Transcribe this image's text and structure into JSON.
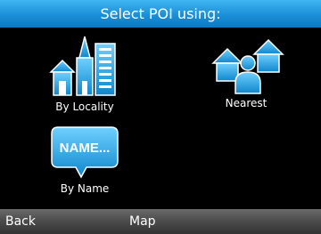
{
  "header": {
    "title": "Select POI using:"
  },
  "options": [
    {
      "label": "By Locality",
      "icon": "city-buildings-icon"
    },
    {
      "label": "Nearest",
      "icon": "nearby-person-houses-icon"
    },
    {
      "label": "By Name",
      "icon": "name-speech-bubble-icon",
      "icon_text": "NAME..."
    }
  ],
  "softkeys": {
    "left": "Back",
    "center": "Map"
  },
  "colors": {
    "title_bar": "#1a8fd8",
    "icon_blue": "#1ba3e8",
    "background": "#000000"
  }
}
